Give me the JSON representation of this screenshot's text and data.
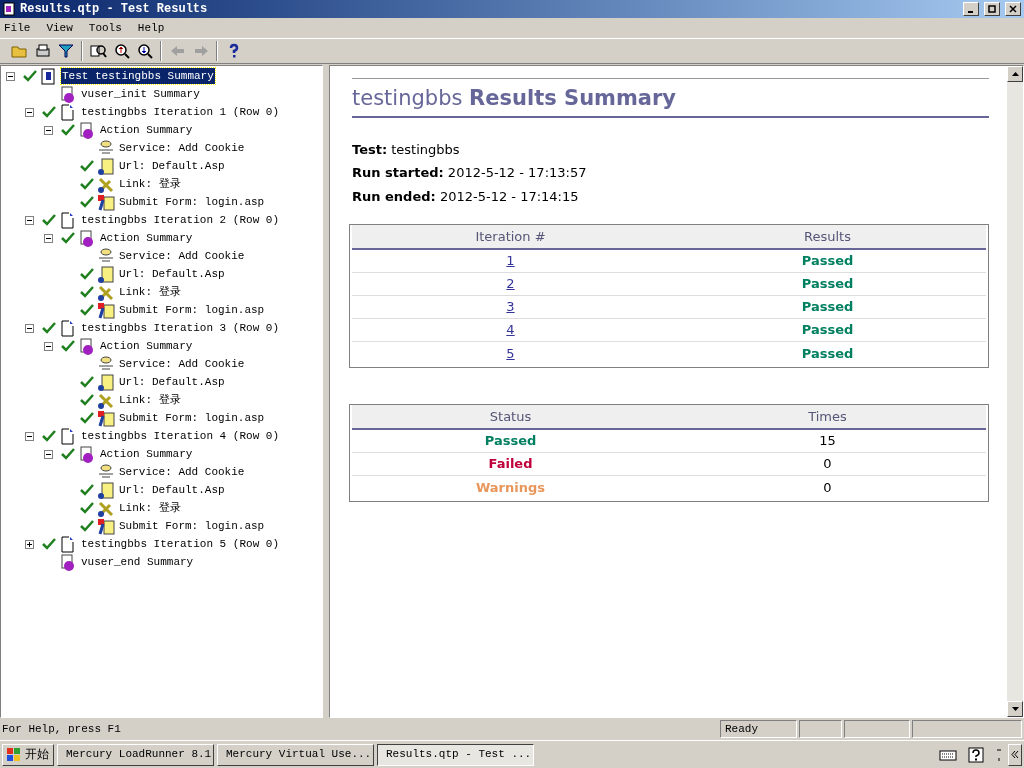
{
  "window": {
    "title": "Results.qtp - Test Results"
  },
  "menu": [
    "File",
    "View",
    "Tools",
    "Help"
  ],
  "tree": [
    {
      "label": "Test testingbbs Summary",
      "kind": "test",
      "passed": true,
      "expanded": true,
      "selected": true,
      "children": [
        {
          "label": "vuser_init Summary",
          "kind": "action",
          "passed": false,
          "selected": false
        },
        {
          "label": "testingbbs Iteration 1 (Row 0)",
          "kind": "iteration",
          "passed": true,
          "expanded": true,
          "selected": false,
          "children": [
            {
              "label": "Action Summary",
              "kind": "action",
              "passed": true,
              "expanded": true,
              "selected": false,
              "children": [
                {
                  "label": "Service: Add Cookie",
                  "kind": "service",
                  "passed": false,
                  "selected": false
                },
                {
                  "label": "Url: Default.Asp",
                  "kind": "url",
                  "passed": true,
                  "selected": false
                },
                {
                  "label": "Link: 登录",
                  "kind": "link",
                  "passed": true,
                  "selected": false
                },
                {
                  "label": "Submit Form: login.asp",
                  "kind": "form",
                  "passed": true,
                  "selected": false
                }
              ]
            }
          ]
        },
        {
          "label": "testingbbs Iteration 2 (Row 0)",
          "kind": "iteration",
          "passed": true,
          "expanded": true,
          "selected": false,
          "children": [
            {
              "label": "Action Summary",
              "kind": "action",
              "passed": true,
              "expanded": true,
              "selected": false,
              "children": [
                {
                  "label": "Service: Add Cookie",
                  "kind": "service",
                  "passed": false,
                  "selected": false
                },
                {
                  "label": "Url: Default.Asp",
                  "kind": "url",
                  "passed": true,
                  "selected": false
                },
                {
                  "label": "Link: 登录",
                  "kind": "link",
                  "passed": true,
                  "selected": false
                },
                {
                  "label": "Submit Form: login.asp",
                  "kind": "form",
                  "passed": true,
                  "selected": false
                }
              ]
            }
          ]
        },
        {
          "label": "testingbbs Iteration 3 (Row 0)",
          "kind": "iteration",
          "passed": true,
          "expanded": true,
          "selected": false,
          "children": [
            {
              "label": "Action Summary",
              "kind": "action",
              "passed": true,
              "expanded": true,
              "selected": false,
              "children": [
                {
                  "label": "Service: Add Cookie",
                  "kind": "service",
                  "passed": false,
                  "selected": false
                },
                {
                  "label": "Url: Default.Asp",
                  "kind": "url",
                  "passed": true,
                  "selected": false
                },
                {
                  "label": "Link: 登录",
                  "kind": "link",
                  "passed": true,
                  "selected": false
                },
                {
                  "label": "Submit Form: login.asp",
                  "kind": "form",
                  "passed": true,
                  "selected": false
                }
              ]
            }
          ]
        },
        {
          "label": "testingbbs Iteration 4 (Row 0)",
          "kind": "iteration",
          "passed": true,
          "expanded": true,
          "selected": false,
          "children": [
            {
              "label": "Action Summary",
              "kind": "action",
              "passed": true,
              "expanded": true,
              "selected": false,
              "children": [
                {
                  "label": "Service: Add Cookie",
                  "kind": "service",
                  "passed": false,
                  "selected": false
                },
                {
                  "label": "Url: Default.Asp",
                  "kind": "url",
                  "passed": true,
                  "selected": false
                },
                {
                  "label": "Link: 登录",
                  "kind": "link",
                  "passed": true,
                  "selected": false
                },
                {
                  "label": "Submit Form: login.asp",
                  "kind": "form",
                  "passed": true,
                  "selected": false
                }
              ]
            }
          ]
        },
        {
          "label": "testingbbs Iteration 5 (Row 0)",
          "kind": "iteration",
          "passed": true,
          "expanded": false,
          "selected": false
        },
        {
          "label": "vuser_end Summary",
          "kind": "action",
          "passed": false,
          "selected": false
        }
      ]
    }
  ],
  "report": {
    "title_name": "testingbbs",
    "title_bold": "Results Summary",
    "fields": [
      {
        "label": "Test:",
        "value": "testingbbs"
      },
      {
        "label": "Run started:",
        "value": "2012-5-12 - 17:13:57"
      },
      {
        "label": "Run ended:",
        "value": "2012-5-12 - 17:14:15"
      }
    ],
    "iterations": {
      "columns": [
        "Iteration #",
        "Results"
      ],
      "rows": [
        {
          "iteration": "1",
          "result": "Passed",
          "color": "#008060"
        },
        {
          "iteration": "2",
          "result": "Passed",
          "color": "#008060"
        },
        {
          "iteration": "3",
          "result": "Passed",
          "color": "#008060"
        },
        {
          "iteration": "4",
          "result": "Passed",
          "color": "#008060"
        },
        {
          "iteration": "5",
          "result": "Passed",
          "color": "#008060"
        }
      ]
    },
    "statuses": {
      "columns": [
        "Status",
        "Times"
      ],
      "rows": [
        {
          "status": "Passed",
          "times": "15",
          "color": "#008060"
        },
        {
          "status": "Failed",
          "times": "0",
          "color": "#c0003c"
        },
        {
          "status": "Warnings",
          "times": "0",
          "color": "#e8965a"
        }
      ]
    }
  },
  "status_bar": {
    "help": "For Help, press F1",
    "state": "Ready"
  },
  "taskbar": {
    "start": "开始",
    "tasks": [
      {
        "label": "Mercury LoadRunner 8.1",
        "selected": false
      },
      {
        "label": "Mercury Virtual Use...",
        "selected": false
      },
      {
        "label": "Results.qtp - Test ...",
        "selected": true
      }
    ]
  }
}
